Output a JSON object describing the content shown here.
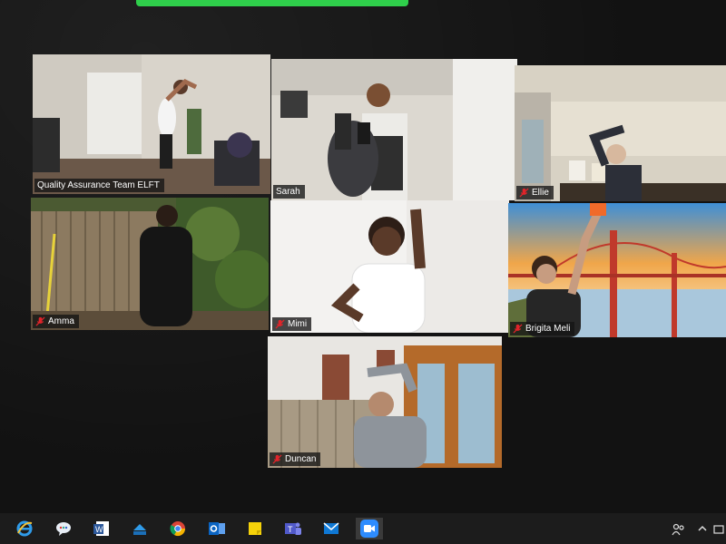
{
  "meeting": {
    "banner_text": "",
    "participants": [
      {
        "name": "Quality Assurance Team ELFT",
        "muted": false
      },
      {
        "name": "Sarah",
        "muted": false,
        "active_speaker": true
      },
      {
        "name": "Ellie",
        "muted": true
      },
      {
        "name": "Amma",
        "muted": true
      },
      {
        "name": "Mimi",
        "muted": true
      },
      {
        "name": "Brigita Meli",
        "muted": true
      },
      {
        "name": "Duncan",
        "muted": true
      }
    ]
  },
  "taskbar": {
    "icons": [
      "internet-explorer-icon",
      "chat-bubble-icon",
      "word-icon",
      "file-transfer-icon",
      "chrome-icon",
      "outlook-icon",
      "sticky-notes-icon",
      "teams-icon",
      "mail-icon",
      "zoom-icon"
    ],
    "tray": [
      "people-icon",
      "chevron-up-icon"
    ]
  },
  "colors": {
    "active_speaker_border": "#c8dd3a",
    "banner": "#2fcf4b",
    "mute_red": "#e0242a"
  }
}
